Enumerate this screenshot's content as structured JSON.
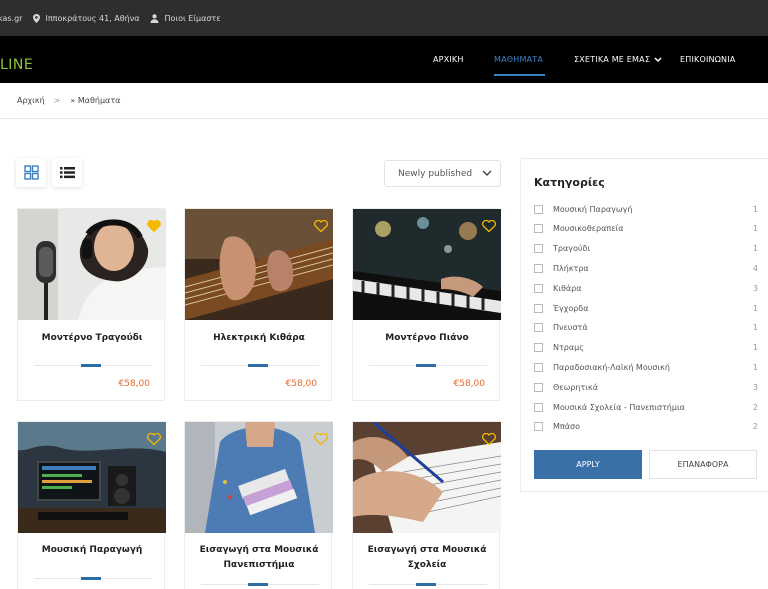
{
  "topbar": {
    "website": "kas.gr",
    "address": "Ιπποκράτους 41, Αθήνα",
    "about": "Ποιοι Είμαστε"
  },
  "header": {
    "logo_text": "LINE",
    "nav": [
      "ΑΡΧΙΚΗ",
      "ΜΑΘΗΜΑΤΑ",
      "ΣΧΕΤΙΚΑ ΜΕ ΕΜΑΣ",
      "ΕΠΙΚΟΙΝΩΝΙΑ"
    ],
    "active_nav": "ΜΑΘΗΜΑΤΑ"
  },
  "breadcrumb": {
    "home": "Αρχική",
    "separator": ">",
    "current": "» Μαθήματα"
  },
  "toolbar": {
    "sort_value": "Newly published"
  },
  "courses": [
    {
      "title": "Μοντέρνο Τραγούδι",
      "price": "€58,00",
      "heart_filled": true,
      "image": "singer-microphone-photo"
    },
    {
      "title": "Ηλεκτρική Κιθάρα",
      "price": "€58,00",
      "heart_filled": false,
      "image": "guitar-playing-photo"
    },
    {
      "title": "Μοντέρνο Πιάνο",
      "price": "€58,00",
      "heart_filled": false,
      "image": "piano-keyboard-photo"
    },
    {
      "title": "Μουσική Παραγωγή",
      "price": "",
      "heart_filled": false,
      "image": "music-studio-photo"
    },
    {
      "title": "Εισαγωγή στα Μουσικά Πανεπιστήμια",
      "price": "",
      "heart_filled": false,
      "image": "student-books-photo"
    },
    {
      "title": "Εισαγωγή στα Μουσικά Σχολεία",
      "price": "",
      "heart_filled": false,
      "image": "writing-notes-photo"
    }
  ],
  "sidebar": {
    "title": "Κατηγορίες",
    "categories": [
      {
        "label": "Μουσική Παραγωγή",
        "count": "1"
      },
      {
        "label": "Μουσικοθεραπεία",
        "count": "1"
      },
      {
        "label": "Τραγούδι",
        "count": "1"
      },
      {
        "label": "Πλήκτρα",
        "count": "4"
      },
      {
        "label": "Κιθάρα",
        "count": "3"
      },
      {
        "label": "Έγχορδα",
        "count": "1"
      },
      {
        "label": "Πνευστά",
        "count": "1"
      },
      {
        "label": "Ντραμς",
        "count": "1"
      },
      {
        "label": "Παραδοσιακή-Λαϊκή Μουσική",
        "count": "1"
      },
      {
        "label": "Θεωρητικά",
        "count": "3"
      },
      {
        "label": "Μουσικά Σχολεία - Πανεπιστήμια",
        "count": "2"
      },
      {
        "label": "Μπάσο",
        "count": "2"
      }
    ],
    "apply_label": "APPLY",
    "reset_label": "ΕΠΑΝΑΦΟΡΑ"
  },
  "colors": {
    "accent": "#3b82c4",
    "price": "#e8692a",
    "logo": "#8cc63f",
    "heart_gold": "#f5b800"
  }
}
